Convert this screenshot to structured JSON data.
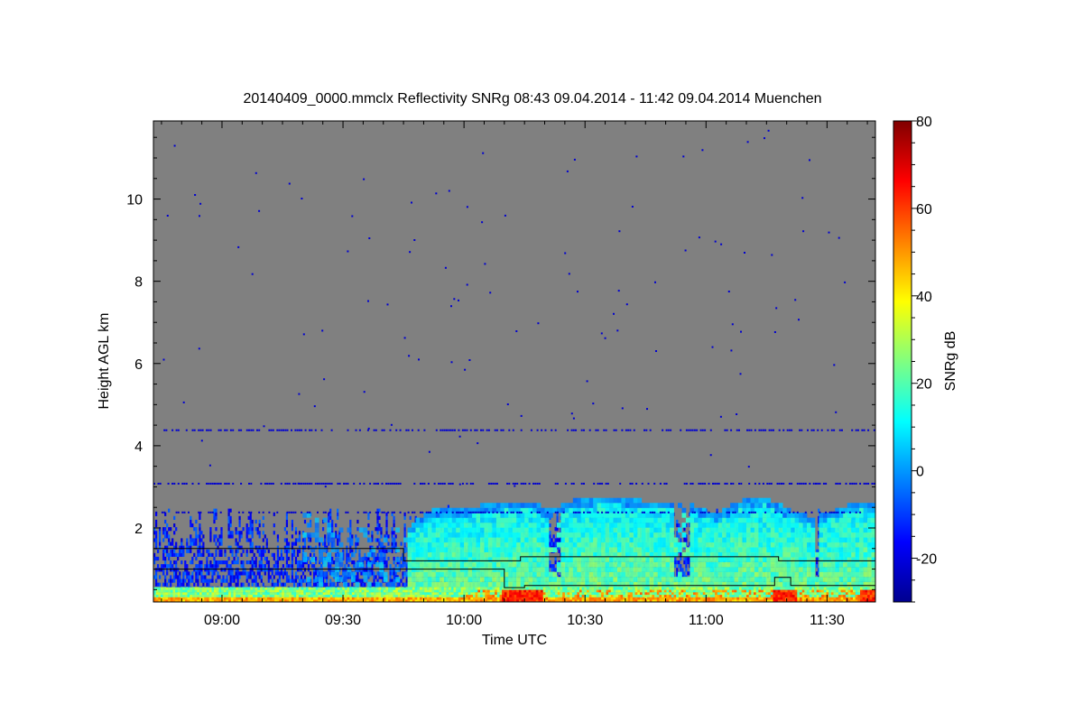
{
  "chart_data": {
    "type": "heatmap",
    "title": "20140409_0000.mmclx Reflectivity SNRg   08:43 09.04.2014 - 11:42 09.04.2014 Muenchen",
    "xlabel": "Time UTC",
    "ylabel": "Height AGL km",
    "colorbar_label": "SNRg dB",
    "x_range_utc": [
      "08:43",
      "11:42"
    ],
    "xlim_minutes_from_0900": [
      -17,
      162
    ],
    "ylim_km": [
      0.2,
      11.9
    ],
    "x_ticks": [
      {
        "label": "09:00",
        "minutes": 0
      },
      {
        "label": "09:30",
        "minutes": 30
      },
      {
        "label": "10:00",
        "minutes": 60
      },
      {
        "label": "10:30",
        "minutes": 90
      },
      {
        "label": "11:00",
        "minutes": 120
      },
      {
        "label": "11:30",
        "minutes": 150
      }
    ],
    "y_ticks": [
      {
        "label": "2",
        "value": 2
      },
      {
        "label": "4",
        "value": 4
      },
      {
        "label": "6",
        "value": 6
      },
      {
        "label": "8",
        "value": 8
      },
      {
        "label": "10",
        "value": 10
      }
    ],
    "colorbar_range_db": [
      -30,
      80
    ],
    "colorbar_ticks": [
      {
        "label": "-20",
        "value": -20
      },
      {
        "label": "0",
        "value": 0
      },
      {
        "label": "20",
        "value": 20
      },
      {
        "label": "40",
        "value": 40
      },
      {
        "label": "60",
        "value": 60
      },
      {
        "label": "80",
        "value": 80
      }
    ],
    "background_color": "#808080",
    "colormap": [
      "#00008f",
      "#0000ff",
      "#0080ff",
      "#00ffff",
      "#80ff80",
      "#ffff00",
      "#ff8000",
      "#ff0000",
      "#800000"
    ],
    "cloud_top_profile_km": [
      {
        "minutes": 20,
        "height": 2.3
      },
      {
        "minutes": 26,
        "height": 2.1
      },
      {
        "minutes": 32,
        "height": 2.0
      },
      {
        "minutes": 40,
        "height": 1.8
      },
      {
        "minutes": 46,
        "height": 2.0
      },
      {
        "minutes": 52,
        "height": 2.4
      },
      {
        "minutes": 58,
        "height": 2.4
      },
      {
        "minutes": 64,
        "height": 2.5
      },
      {
        "minutes": 70,
        "height": 2.6
      },
      {
        "minutes": 76,
        "height": 2.6
      },
      {
        "minutes": 80,
        "height": 2.4
      },
      {
        "minutes": 86,
        "height": 2.6
      },
      {
        "minutes": 92,
        "height": 2.7
      },
      {
        "minutes": 98,
        "height": 2.7
      },
      {
        "minutes": 104,
        "height": 2.6
      },
      {
        "minutes": 110,
        "height": 2.6
      },
      {
        "minutes": 116,
        "height": 2.5
      },
      {
        "minutes": 122,
        "height": 2.3
      },
      {
        "minutes": 128,
        "height": 2.6
      },
      {
        "minutes": 134,
        "height": 2.7
      },
      {
        "minutes": 140,
        "height": 2.4
      },
      {
        "minutes": 146,
        "height": 2.2
      },
      {
        "minutes": 152,
        "height": 2.4
      },
      {
        "minutes": 158,
        "height": 2.6
      },
      {
        "minutes": 162,
        "height": 2.5
      }
    ],
    "overlay_line_km": [
      {
        "minutes": -17,
        "height": 1.5
      },
      {
        "minutes": 45,
        "height": 1.5
      },
      {
        "minutes": 45,
        "height": 1.2
      },
      {
        "minutes": 74,
        "height": 1.2
      },
      {
        "minutes": 74,
        "height": 1.3
      },
      {
        "minutes": 138,
        "height": 1.3
      },
      {
        "minutes": 138,
        "height": 1.2
      },
      {
        "minutes": 162,
        "height": 1.2
      }
    ],
    "overlay_line2_km": [
      {
        "minutes": -17,
        "height": 1.0
      },
      {
        "minutes": 70,
        "height": 1.0
      },
      {
        "minutes": 70,
        "height": 0.55
      },
      {
        "minutes": 75,
        "height": 0.55
      },
      {
        "minutes": 75,
        "height": 0.6
      },
      {
        "minutes": 137,
        "height": 0.6
      },
      {
        "minutes": 137,
        "height": 0.8
      },
      {
        "minutes": 141,
        "height": 0.8
      },
      {
        "minutes": 141,
        "height": 0.6
      },
      {
        "minutes": 162,
        "height": 0.6
      }
    ],
    "noise_layers_km": [
      2.4,
      3.1,
      4.4
    ],
    "ground_band_km": 0.3,
    "strong_echo_periods_minutes": [
      [
        69,
        79
      ],
      [
        136,
        142
      ],
      [
        158,
        162
      ]
    ]
  }
}
